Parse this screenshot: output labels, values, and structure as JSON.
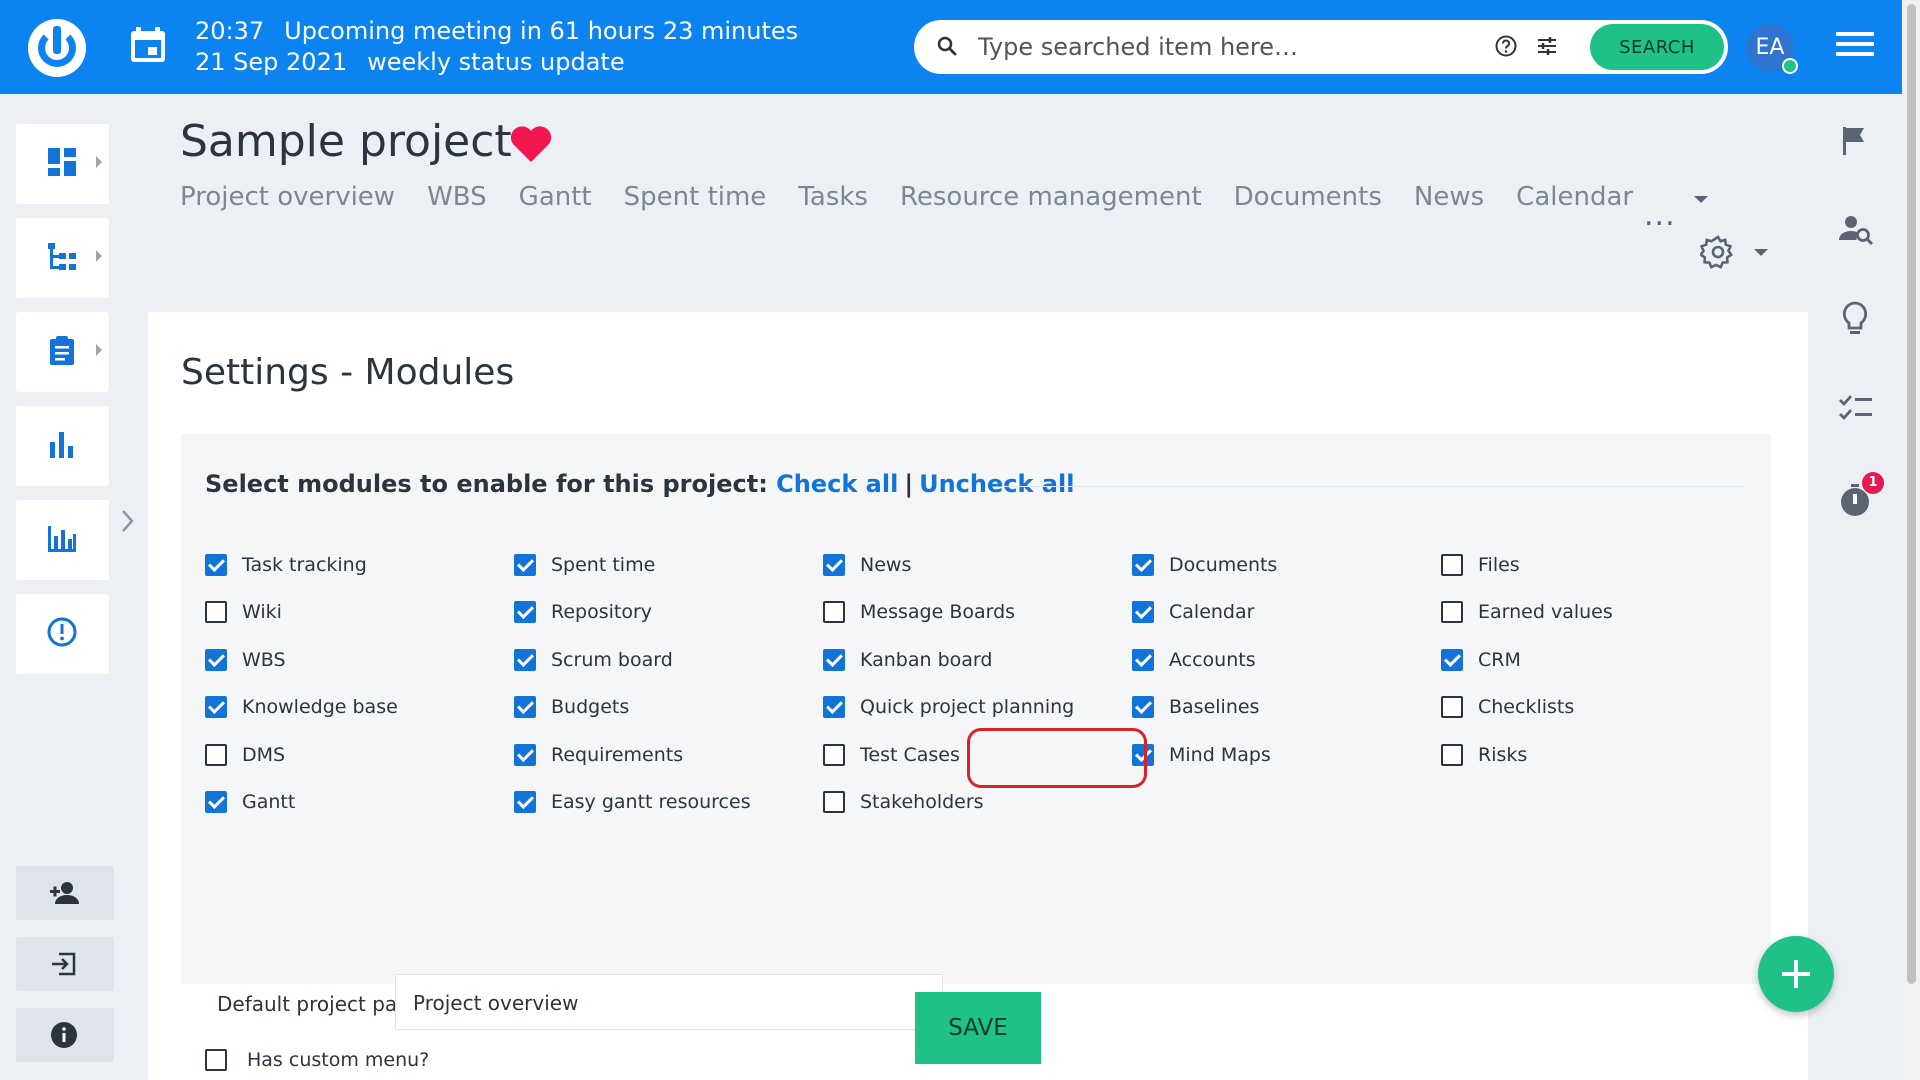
{
  "topbar": {
    "time": "20:37",
    "meeting": "Upcoming meeting in 61 hours 23 minutes",
    "date": "21 Sep 2021",
    "meeting_name": "weekly status update",
    "search_placeholder": "Type searched item here…",
    "search_button": "SEARCH",
    "avatar_initials": "EA",
    "logo_icon": "easy-logo-icon",
    "calendar_icon": "calendar-icon",
    "menu_icon": "hamburger-menu-icon"
  },
  "left_sidebar": {
    "items": [
      {
        "icon": "dashboard-icon"
      },
      {
        "icon": "hierarchy-icon"
      },
      {
        "icon": "clipboard-icon"
      },
      {
        "icon": "bar-chart-icon"
      },
      {
        "icon": "column-chart-icon"
      },
      {
        "icon": "alert-icon"
      }
    ],
    "bottom": [
      {
        "icon": "add-user-icon"
      },
      {
        "icon": "sign-in-icon"
      },
      {
        "icon": "info-icon"
      }
    ]
  },
  "right_sidebar": {
    "icons": [
      "flag-icon",
      "user-search-icon",
      "lightbulb-icon",
      "checklist-icon",
      "timer-icon"
    ],
    "timer_badge": "1"
  },
  "project": {
    "title": "Sample project",
    "nav": [
      "Project overview",
      "WBS",
      "Gantt",
      "Spent time",
      "Tasks",
      "Resource management",
      "Documents",
      "News",
      "Calendar"
    ],
    "more": "...",
    "favorite_color": "#f0164f"
  },
  "settings": {
    "title": "Settings - Modules",
    "heading": "Select modules to enable for this project:",
    "check_all": "Check all",
    "separator": "|",
    "uncheck_all": "Uncheck all",
    "modules": [
      {
        "label": "Task tracking",
        "checked": true
      },
      {
        "label": "Spent time",
        "checked": true
      },
      {
        "label": "News",
        "checked": true
      },
      {
        "label": "Documents",
        "checked": true
      },
      {
        "label": "Files",
        "checked": false
      },
      {
        "label": "Wiki",
        "checked": false
      },
      {
        "label": "Repository",
        "checked": true
      },
      {
        "label": "Message Boards",
        "checked": false
      },
      {
        "label": "Calendar",
        "checked": true
      },
      {
        "label": "Earned values",
        "checked": false
      },
      {
        "label": "WBS",
        "checked": true
      },
      {
        "label": "Scrum board",
        "checked": true
      },
      {
        "label": "Kanban board",
        "checked": true
      },
      {
        "label": "Accounts",
        "checked": true
      },
      {
        "label": "CRM",
        "checked": true
      },
      {
        "label": "Knowledge base",
        "checked": true
      },
      {
        "label": "Budgets",
        "checked": true
      },
      {
        "label": "Quick project planning",
        "checked": true
      },
      {
        "label": "Baselines",
        "checked": true
      },
      {
        "label": "Checklists",
        "checked": false
      },
      {
        "label": "DMS",
        "checked": false
      },
      {
        "label": "Requirements",
        "checked": true
      },
      {
        "label": "Test Cases",
        "checked": false
      },
      {
        "label": "Mind Maps",
        "checked": true
      },
      {
        "label": "Risks",
        "checked": false
      },
      {
        "label": "Gantt",
        "checked": true
      },
      {
        "label": "Easy gantt resources",
        "checked": true
      },
      {
        "label": "Stakeholders",
        "checked": false
      }
    ],
    "default_page_label": "Default project page",
    "default_page_value": "Project overview",
    "custom_menu_label": "Has custom menu?",
    "custom_menu_checked": false,
    "save": "SAVE"
  },
  "colors": {
    "primary": "#0b83f0",
    "accent_green": "#1ec186",
    "link": "#1273d8",
    "highlight_ring": "#d8232a"
  }
}
